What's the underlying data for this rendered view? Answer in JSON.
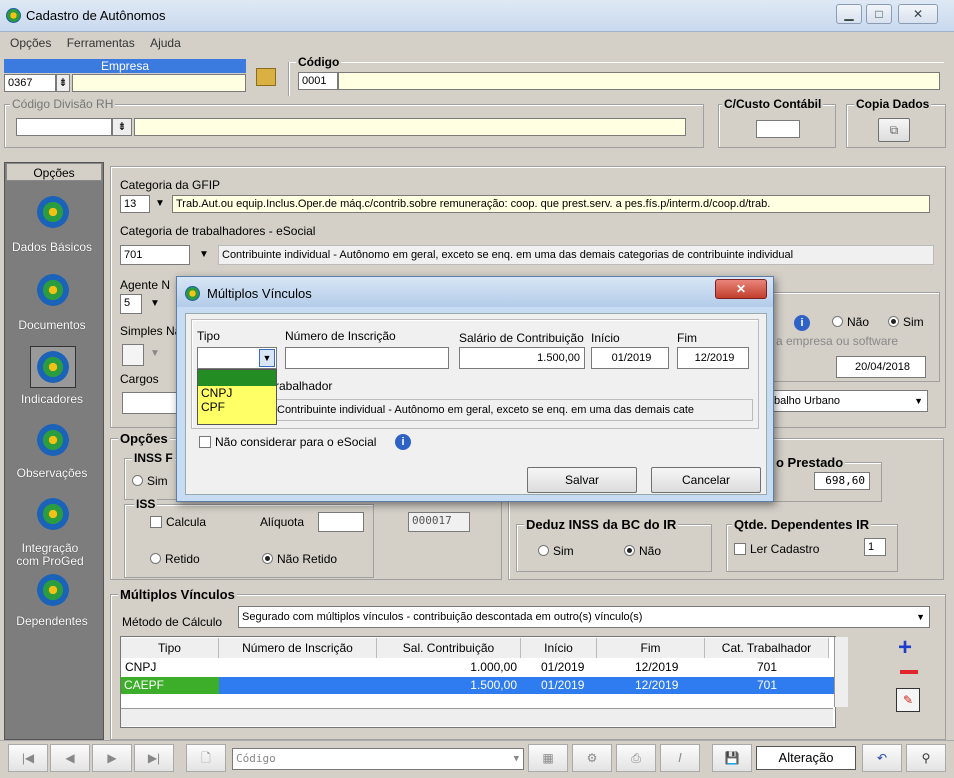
{
  "window": {
    "title": "Cadastro de Autônomos"
  },
  "menu": [
    "Opções",
    "Ferramentas",
    "Ajuda"
  ],
  "empresa": {
    "label": "Empresa",
    "value": "0367"
  },
  "codigo": {
    "label": "Código",
    "value": "0001"
  },
  "divisao": {
    "label": "Código Divisão RH"
  },
  "custo": {
    "label": "C/Custo Contábil"
  },
  "copia": {
    "label": "Copia Dados"
  },
  "side": {
    "title": "Opções",
    "items": [
      "Dados Básicos",
      "Documentos",
      "Indicadores",
      "Observações",
      "Integração com ProGed",
      "Dependentes"
    ]
  },
  "gfip": {
    "label": "Categoria da GFIP",
    "code": "13",
    "desc": "Trab.Aut.ou equip.Inclus.Oper.de máq.c/contrib.sobre remuneração: coop. que prest.serv. a pes.fís.p/interm.d/coop.d/trab."
  },
  "esocial": {
    "label": "Categoria de trabalhadores - eSocial",
    "code": "701",
    "desc": "Contribuinte individual - Autônomo em geral, exceto se enq. em uma das demais categorias de contribuinte individual"
  },
  "agente": {
    "label": "Agente N",
    "value": "5"
  },
  "simples": {
    "label": "Simples Na"
  },
  "cargos": {
    "label": "Cargos"
  },
  "right": {
    "nao": "Não",
    "sim": "Sim",
    "hint": "a empresa ou software",
    "date": "20/04/2018",
    "urbano": "balho Urbano"
  },
  "opcoes": {
    "title": "Opções",
    "inss": "INSS F",
    "sim": "Sim",
    "iss": "ISS",
    "calcula": "Calcula",
    "aliquota": "Alíquota",
    "retido": "Retido",
    "nao_retido": "Não Retido",
    "code": "000017"
  },
  "prestado": {
    "title": "o Prestado",
    "value": "698,60"
  },
  "deduz": {
    "title": "Deduz INSS da BC do IR",
    "sim": "Sim",
    "nao": "Não"
  },
  "dep": {
    "title": "Qtde. Dependentes IR",
    "ler": "Ler Cadastro",
    "value": "1"
  },
  "mv": {
    "title": "Múltiplos Vínculos",
    "metodo_label": "Método de Cálculo",
    "metodo": "Segurado com múltiplos vínculos - contribuição descontada em outro(s) vínculo(s)",
    "headers": [
      "Tipo",
      "Número de Inscrição",
      "Sal. Contribuição",
      "Início",
      "Fim",
      "Cat. Trabalhador"
    ],
    "rows": [
      [
        "CNPJ",
        "",
        "1.000,00",
        "01/2019",
        "12/2019",
        "701"
      ],
      [
        "CAEPF",
        "",
        "1.500,00",
        "01/2019",
        "12/2019",
        "701"
      ]
    ]
  },
  "dialog": {
    "title": "Múltiplos Vínculos",
    "tipo": "Tipo",
    "numero": "Número de Inscrição",
    "salario": "Salário de Contribuição",
    "salario_val": "1.500,00",
    "inicio": "Início",
    "inicio_val": "01/2019",
    "fim": "Fim",
    "fim_val": "12/2019",
    "options": [
      "CNPJ",
      "CPF"
    ],
    "trab": "rabalhador",
    "trab_desc": "Contribuinte individual - Autônomo em geral, exceto se enq. em uma das demais cate",
    "nao_considerar": "Não considerar para o eSocial",
    "salvar": "Salvar",
    "cancelar": "Cancelar"
  },
  "toolbar": {
    "codigo": "Código",
    "mode": "Alteração"
  }
}
